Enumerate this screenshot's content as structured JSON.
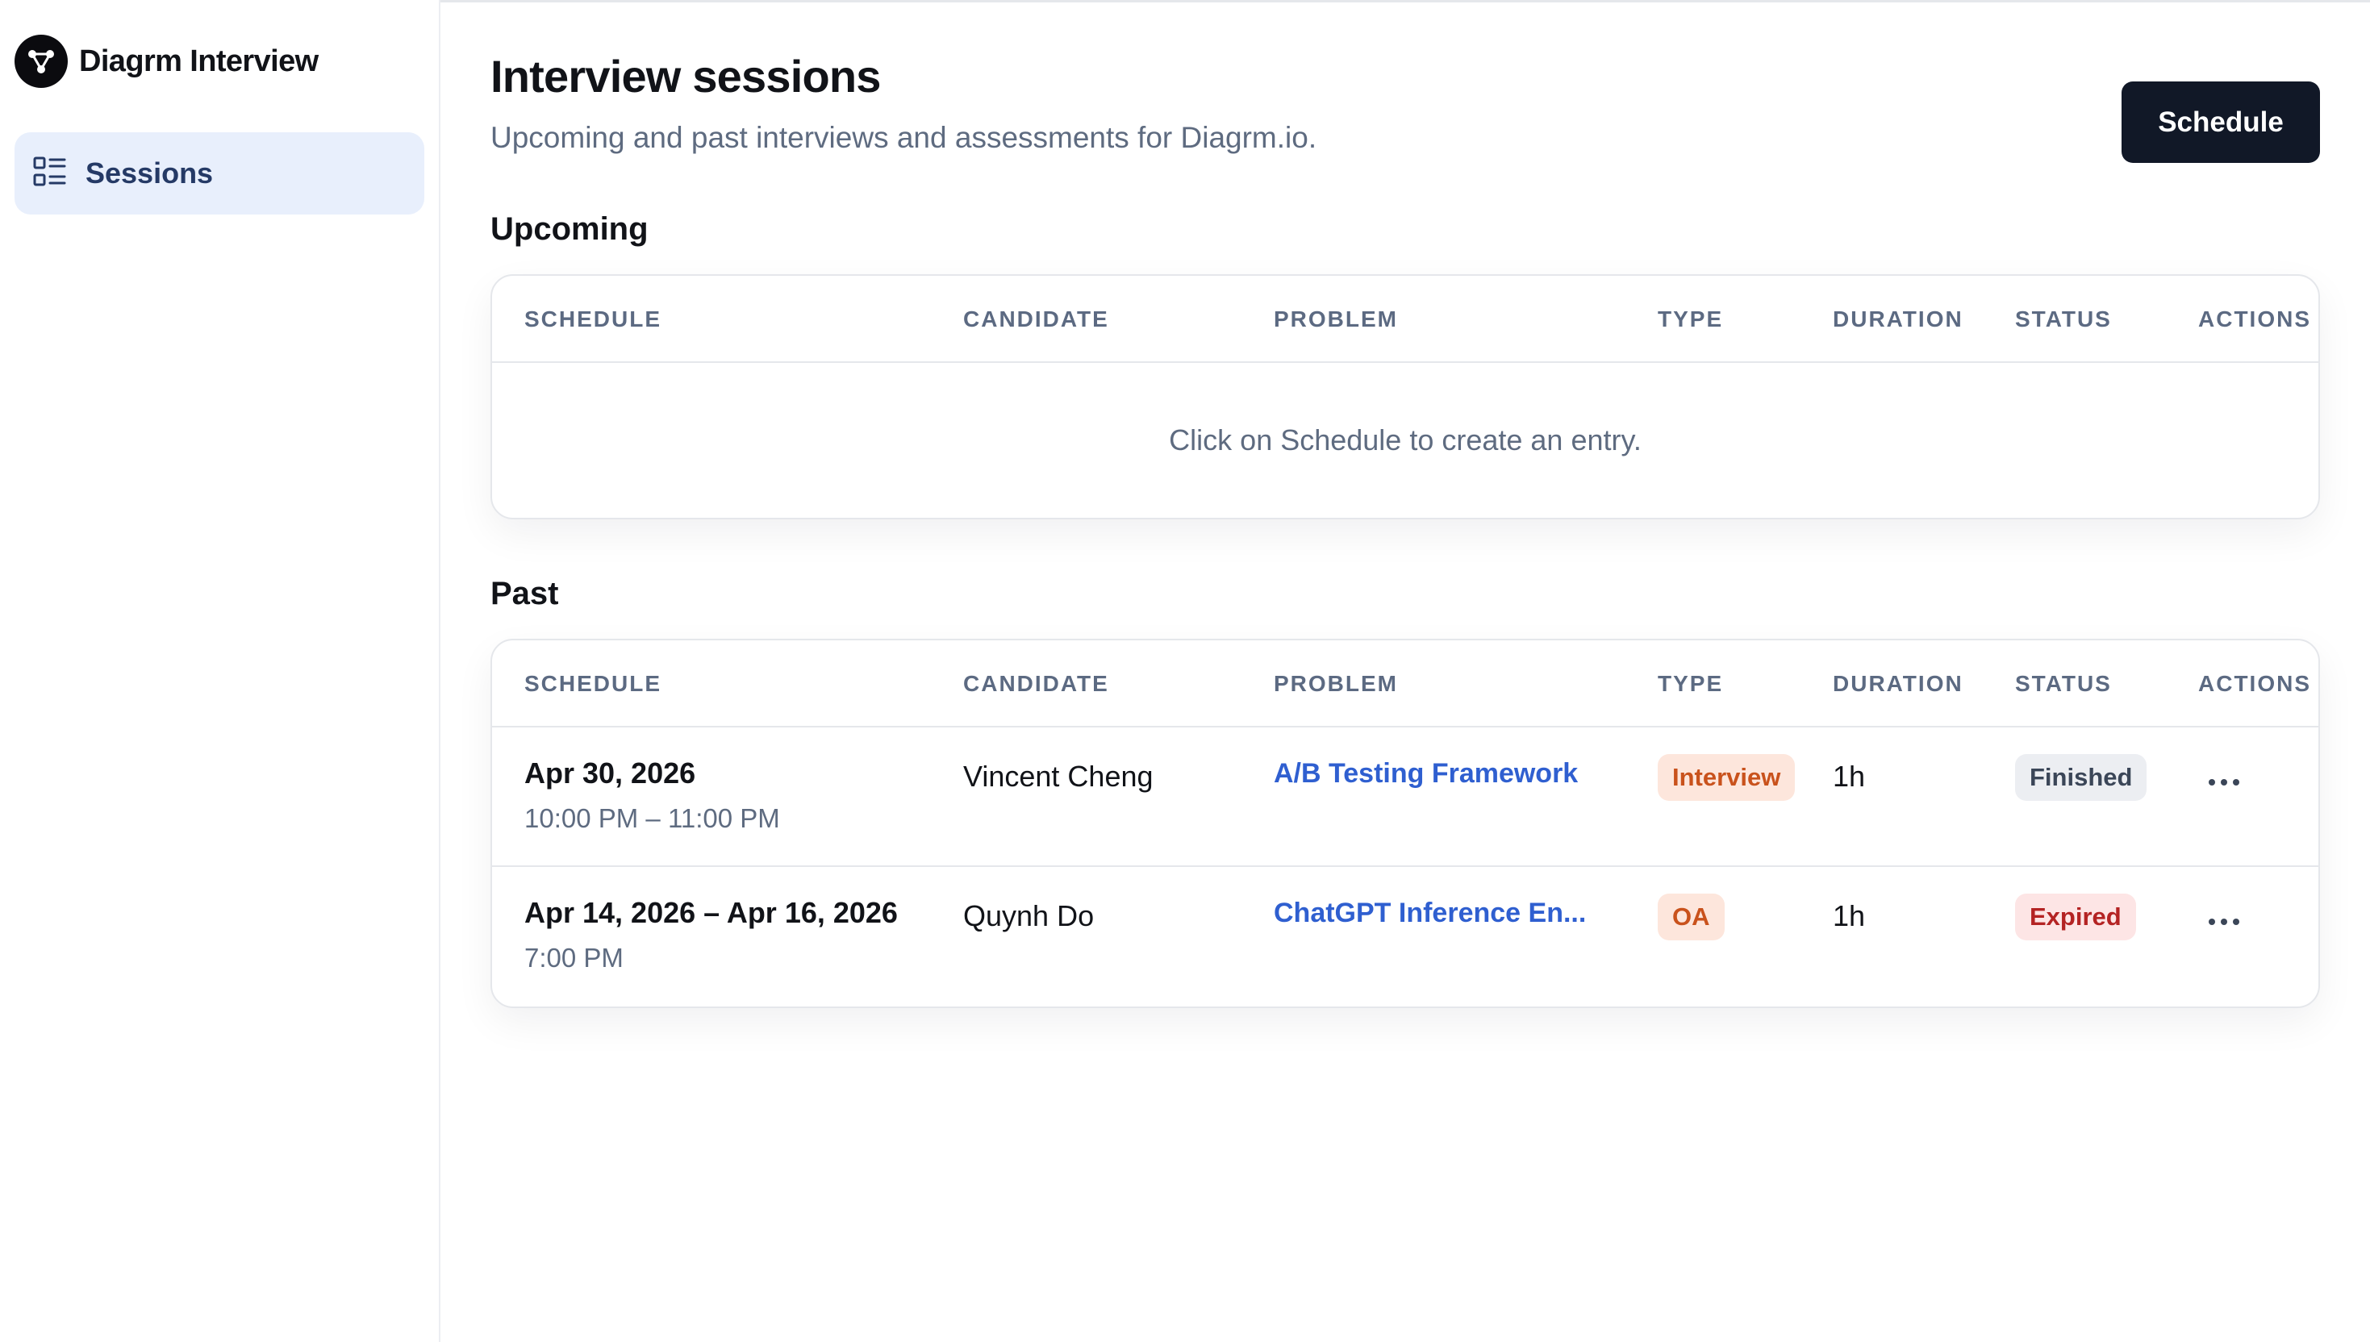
{
  "app": {
    "name": "Diagrm Interview"
  },
  "sidebar": {
    "items": [
      {
        "label": "Sessions",
        "icon": "list-icon",
        "active": true
      }
    ]
  },
  "header": {
    "title": "Interview sessions",
    "subtitle": "Upcoming and past interviews and assessments for Diagrm.io.",
    "schedule_label": "Schedule"
  },
  "table_columns": [
    "SCHEDULE",
    "CANDIDATE",
    "PROBLEM",
    "TYPE",
    "DURATION",
    "STATUS",
    "ACTIONS"
  ],
  "upcoming": {
    "title": "Upcoming",
    "empty_text": "Click on Schedule to create an entry."
  },
  "past": {
    "title": "Past",
    "rows": [
      {
        "date": "Apr 30, 2026",
        "time": "10:00 PM – 11:00 PM",
        "candidate": "Vincent Cheng",
        "problem": "A/B Testing Framework",
        "type": "Interview",
        "duration": "1h",
        "status": "Finished"
      },
      {
        "date": "Apr 14, 2026 – Apr 16, 2026",
        "time": "7:00 PM",
        "candidate": "Quynh Do",
        "problem": "ChatGPT Inference En...",
        "type": "OA",
        "duration": "1h",
        "status": "Expired"
      }
    ]
  },
  "colors": {
    "accent_dark": "#111827",
    "link": "#2f5fd0",
    "nav_active_bg": "#e8effc",
    "badge_interview": "#c9521c",
    "badge_expired": "#b42323"
  }
}
